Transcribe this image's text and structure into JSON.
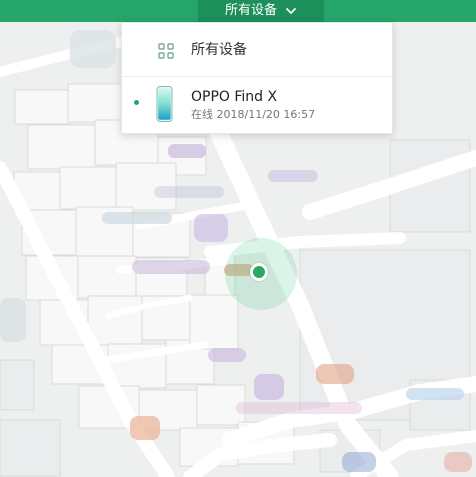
{
  "header": {
    "selector_label": "所有设备"
  },
  "dropdown": {
    "all_devices_label": "所有设备",
    "device": {
      "name": "OPPO Find X",
      "status": "在线 2018/11/20 16:57"
    }
  },
  "colors": {
    "brand_green": "#25a56a",
    "brand_green_dark": "#1c8f5b",
    "location_green": "#2aa868"
  },
  "icons": {
    "selector_caret": "chevron-down-icon",
    "all_devices": "grid-icon",
    "device": "phone-icon",
    "current_location": "location-dot"
  }
}
